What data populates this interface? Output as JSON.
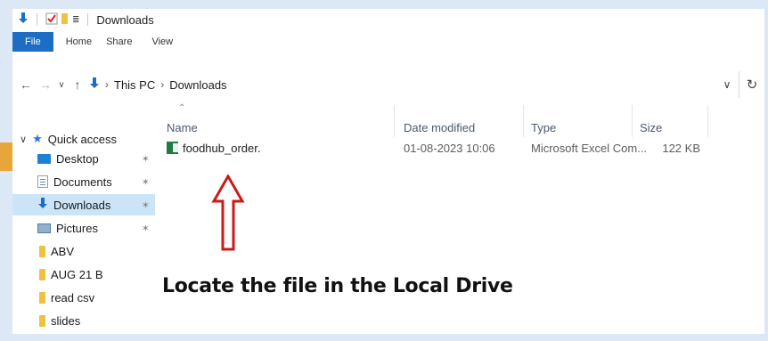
{
  "window": {
    "title": "Downloads"
  },
  "ribbon": {
    "tabs": [
      "File",
      "Home",
      "Share",
      "View"
    ]
  },
  "address": {
    "crumbs": [
      "This PC",
      "Downloads"
    ]
  },
  "nav": {
    "quick_access": "Quick access",
    "items": [
      {
        "label": "Desktop",
        "icon": "desktop-icon",
        "pinned": true
      },
      {
        "label": "Documents",
        "icon": "documents-icon",
        "pinned": true
      },
      {
        "label": "Downloads",
        "icon": "downloads-icon",
        "pinned": true,
        "selected": true
      },
      {
        "label": "Pictures",
        "icon": "pictures-icon",
        "pinned": true
      },
      {
        "label": "ABV",
        "icon": "folder-icon"
      },
      {
        "label": "AUG 21 B",
        "icon": "folder-icon"
      },
      {
        "label": "read csv",
        "icon": "folder-icon"
      },
      {
        "label": "slides",
        "icon": "folder-icon"
      }
    ]
  },
  "file_list": {
    "columns": [
      "Name",
      "Date modified",
      "Type",
      "Size"
    ],
    "rows": [
      {
        "name": "foodhub_order.",
        "date": "01-08-2023 10:06",
        "type": "Microsoft Excel Com...",
        "size": "122 KB"
      }
    ]
  },
  "annotation": {
    "text": "Locate the file in the Local Drive",
    "arrow_color": "#cc1a1a"
  },
  "colors": {
    "file_tab": "#1e6dc4",
    "selected_bg": "#cce4f7",
    "frame_bg": "#dde8f7",
    "accent_block": "#e8a53a"
  }
}
